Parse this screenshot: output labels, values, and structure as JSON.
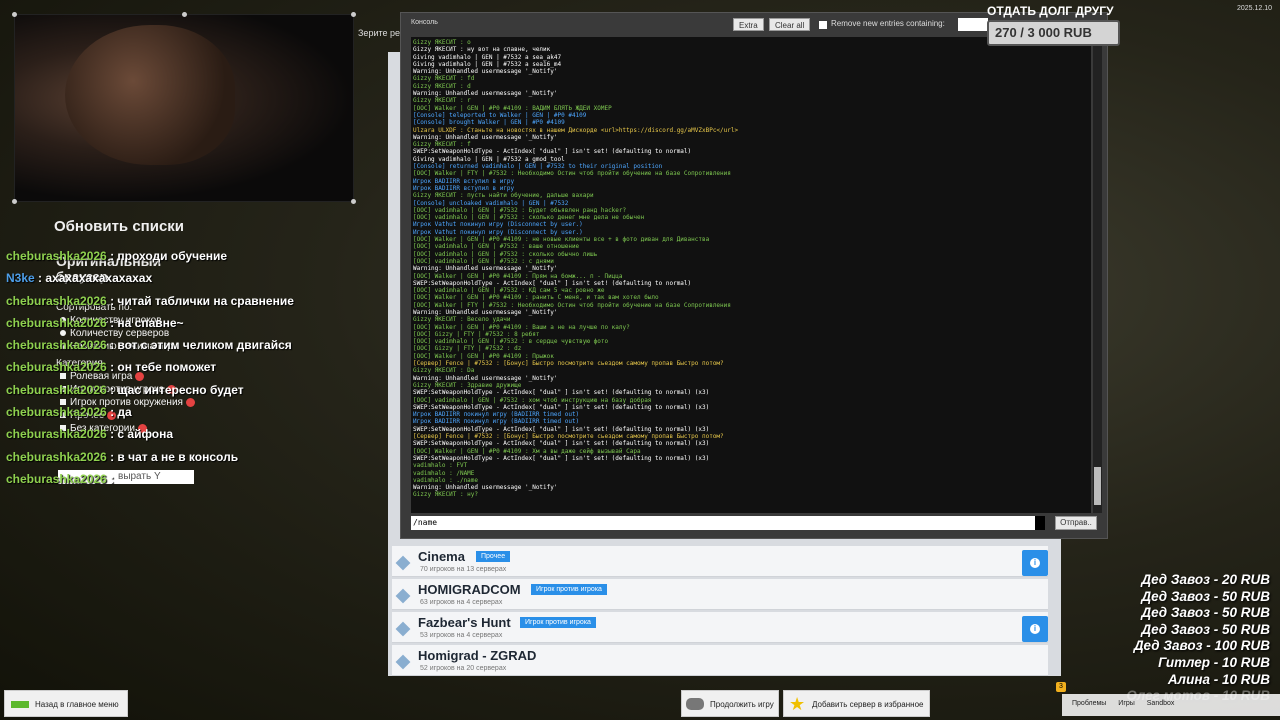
{
  "stream": {
    "refresh_lists": "Обновить списки",
    "zerite_text": "Зерите ре",
    "chat": [
      {
        "user": "cheburashka2026",
        "msg": " : проходи обучение",
        "user_color": "green"
      },
      {
        "user": "N3ke",
        "msg": " : ахахахахахахахах",
        "user_color": "blue"
      },
      {
        "user": "cheburashka2026",
        "msg": " : читай таблички на сравнение",
        "user_color": "green"
      },
      {
        "user": "cheburashka2026",
        "msg": " : на спавне~",
        "user_color": "green"
      },
      {
        "user": "cheburashka2026",
        "msg": " : вот с этим челиком двигайся",
        "user_color": "green"
      },
      {
        "user": "cheburashka2026",
        "msg": " : он тебе поможет",
        "user_color": "green"
      },
      {
        "user": "cheburashka2026",
        "msg": " : щас интересно будет",
        "user_color": "green"
      },
      {
        "user": "cheburashka2026",
        "msg": " : да",
        "user_color": "green"
      },
      {
        "user": "cheburashka2026",
        "msg": " : с айфона",
        "user_color": "green"
      },
      {
        "user": "cheburashka2026",
        "msg": " : в чат а не в консоль",
        "user_color": "green"
      },
      {
        "user": "cheburashka2026",
        "msg": " : ",
        "user_color": "green"
      }
    ],
    "filter": {
      "original": "Оригинальный",
      "browser": "браузер",
      "sort_by": "Сортировать по:",
      "sort_options": [
        "Количеству игроков",
        "Количеству серверов",
        "Названию режима игры"
      ],
      "category_label": "Категория",
      "categories": [
        "Ролевая игра",
        "Игрок против игрока",
        "Игрок против окружения",
        "Прочее",
        "Без категории"
      ],
      "search_hint": "вырать Y"
    }
  },
  "console": {
    "title": "Консоль",
    "extra_label": "Extra",
    "clear_label": "Clear all",
    "remove_label": "Remove new entries containing:",
    "input_value": "/name",
    "send_label": "Отправ..",
    "log": [
      {
        "t": "Gizzy ЯКЕСИТ : о",
        "c": "#7ec850"
      },
      {
        "t": "Gizzy ЯКЕСИТ : ну вот на спавне, челик",
        "c": "#ffffff"
      },
      {
        "t": "Giving vadimhalo | GEN | #7532 a sea_ak47",
        "c": "#ffffff"
      },
      {
        "t": "Giving vadimhalo | GEN | #7532 a sea16_m4",
        "c": "#ffffff"
      },
      {
        "t": "Warning: Unhandled usermessage '_Notify'",
        "c": "#ffffff"
      },
      {
        "t": "Gizzy ЯКЕСИТ : fd",
        "c": "#7ec850"
      },
      {
        "t": "Gizzy ЯКЕСИТ : d",
        "c": "#7ec850"
      },
      {
        "t": "Warning: Unhandled usermessage '_Notify'",
        "c": "#ffffff"
      },
      {
        "t": "Gizzy ЯКЕСИТ : r",
        "c": "#7ec850"
      },
      {
        "t": "[ООС] Walker | GEN | #P0 #4109 : ВАДИМ БЛЯТЬ ЖДЕЙ ХОМЕР",
        "c": "#7ec850"
      },
      {
        "t": "[Console] teleported to Walker | GEN | #P0 #4109",
        "c": "#4da6ff"
      },
      {
        "t": "[Console] brought Walker | GEN | #P0 #4109",
        "c": "#4da6ff"
      },
      {
        "t": "Ulzara ULXDF : Станьте на новостях в нашем Дискорде <url>https://discord.gg/aMVZxBPc</url>",
        "c": "#e8c84a"
      },
      {
        "t": "Warning: Unhandled usermessage '_Notify'",
        "c": "#ffffff"
      },
      {
        "t": "Gizzy ЯКЕСИТ : f",
        "c": "#7ec850"
      },
      {
        "t": "SWEP:SetWeaponHoldType - ActIndex[ \"dual\" ] isn't set! (defaulting to normal)",
        "c": "#ffffff"
      },
      {
        "t": "Giving vadimhalo | GEN | #7532 a gmod_tool",
        "c": "#ffffff"
      },
      {
        "t": "[Console] returned vadimhalo | GEN | #7532 to their original position",
        "c": "#4da6ff"
      },
      {
        "t": "[ООС] Walker | FTY | #7532 : Необходимо Остин чтоб пройти обучение на базе Сопротивления",
        "c": "#7ec850"
      },
      {
        "t": "Игрок BADIIRR вступил в игру",
        "c": "#4da6ff"
      },
      {
        "t": "Игрок BADIIRR вступил в игру",
        "c": "#4da6ff"
      },
      {
        "t": "Gizzy ЯКЕСИТ : пусть найти обучение, дальше вахари",
        "c": "#7ec850"
      },
      {
        "t": "[Console] uncloaked vadimhalo | GEN | #7532",
        "c": "#4da6ff"
      },
      {
        "t": "[ООС] vadimhalo | GEN | #7532 : Будет обьявлен ранд hacker?",
        "c": "#7ec850"
      },
      {
        "t": "[ООС] vadimhalo | GEN | #7532 : сколько денег мне дела не обычен",
        "c": "#7ec850"
      },
      {
        "t": "Игрок Vathut покинул игру (Disconnect by user.)",
        "c": "#4da6ff"
      },
      {
        "t": "Игрок Vathut покинул игру (Disconnect by user.)",
        "c": "#4da6ff"
      },
      {
        "t": "[ООС] Walker | GEN | #P0 #4109 : не новые клиенты все + в фото диван для Диванства",
        "c": "#7ec850"
      },
      {
        "t": "[ООС] vadimhalo | GEN | #7532 : ваше отношение",
        "c": "#7ec850"
      },
      {
        "t": "[ООС] vadimhalo | GEN | #7532 : сколько обычно лишь",
        "c": "#7ec850"
      },
      {
        "t": "[ООС] vadimhalo | GEN | #7532 : с днями",
        "c": "#7ec850"
      },
      {
        "t": "Warning: Unhandled usermessage '_Notify'",
        "c": "#ffffff"
      },
      {
        "t": "[ООС] Walker | GEN | #P0 #4109 : Прям на бомж... п - Пицца",
        "c": "#7ec850"
      },
      {
        "t": "SWEP:SetWeaponHoldType - ActIndex[ \"dual\" ] isn't set! (defaulting to normal)",
        "c": "#ffffff"
      },
      {
        "t": "[ООС] vadimhalo | GEN | #7532 : КД сам 5 час ровно же",
        "c": "#7ec850"
      },
      {
        "t": "[ООС] Walker | GEN | #P0 #4109 : ранить С меня, и так вам хотел было",
        "c": "#7ec850"
      },
      {
        "t": "[ООС] Walker | FTY | #7532 : Необходимо Остин чтоб пройти обучение на базе Сопротивления",
        "c": "#7ec850"
      },
      {
        "t": "Warning: Unhandled usermessage '_Notify'",
        "c": "#ffffff"
      },
      {
        "t": "Gizzy ЯКЕСИТ : Весело удачи",
        "c": "#7ec850"
      },
      {
        "t": "[ООС] Walker | GEN | #P0 #4109 : Ваши а не на лучше по калу?",
        "c": "#7ec850"
      },
      {
        "t": "[ООС] Gizzy | FTY | #7532 : 8 ребят",
        "c": "#7ec850"
      },
      {
        "t": "[ООС] vadimhalo | GEN | #7532 : в сердце чувствую фото",
        "c": "#7ec850"
      },
      {
        "t": "[ООС] Gizzy | FTY | #7532 : dz",
        "c": "#7ec850"
      },
      {
        "t": "[ООС] Walker | GEN | #P0 #4109 : Прыжок",
        "c": "#7ec850"
      },
      {
        "t": "[Сервер] Fence | #7532 : [Бонус] Быстро посмотрите сьездом самому пропав Быстро потом?",
        "c": "#e8c84a"
      },
      {
        "t": "Gizzy ЯКЕСИТ : Da",
        "c": "#7ec850"
      },
      {
        "t": "Warning: Unhandled usermessage '_Notify'",
        "c": "#ffffff"
      },
      {
        "t": "Gizzy ЯКЕСИТ : Здравие дружище",
        "c": "#7ec850"
      },
      {
        "t": "SWEP:SetWeaponHoldType - ActIndex[ \"dual\" ] isn't set! (defaulting to normal) (x3)",
        "c": "#ffffff"
      },
      {
        "t": "[ООС] vadimhalo | GEN | #7532 : хом чтоб инструкцию на базу добрая",
        "c": "#7ec850"
      },
      {
        "t": "SWEP:SetWeaponHoldType - ActIndex[ \"dual\" ] isn't set! (defaulting to normal) (x3)",
        "c": "#ffffff"
      },
      {
        "t": "Игрок BADIIRR покинул игру (BADIIRR timed out)",
        "c": "#4da6ff"
      },
      {
        "t": "Игрок BADIIRR покинул игру (BADIIRR timed out)",
        "c": "#4da6ff"
      },
      {
        "t": "SWEP:SetWeaponHoldType - ActIndex[ \"dual\" ] isn't set! (defaulting to normal) (x3)",
        "c": "#ffffff"
      },
      {
        "t": "[Сервер] Fence | #7532 : [Бонус] Быстро посмотрите сьездом самому пропав Быстро потом?",
        "c": "#e8c84a"
      },
      {
        "t": "SWEP:SetWeaponHoldType - ActIndex[ \"dual\" ] isn't set! (defaulting to normal) (x3)",
        "c": "#ffffff"
      },
      {
        "t": "[ООС] Walker | GEN | #P0 #4109 : Хм а вы даже сейф вызывай Сара",
        "c": "#7ec850"
      },
      {
        "t": "SWEP:SetWeaponHoldType - ActIndex[ \"dual\" ] isn't set! (defaulting to normal) (x3)",
        "c": "#ffffff"
      },
      {
        "t": "vadimhalo : FVT",
        "c": "#7ec850"
      },
      {
        "t": "vadimhalo : /NAME",
        "c": "#7ec850"
      },
      {
        "t": "vadimhalo : ./name",
        "c": "#7ec850"
      },
      {
        "t": "Warning: Unhandled usermessage '_Notify'",
        "c": "#ffffff"
      },
      {
        "t": "Gizzy ЯКЕСИТ : ну?",
        "c": "#7ec850"
      }
    ]
  },
  "servers": [
    {
      "name": "Cinema",
      "tag": "Прочее",
      "sub": "70 игроков на 13 серверах",
      "info": true
    },
    {
      "name": "HOMIGRADCOM",
      "tag": "Игрок против игрока",
      "sub": "63 игроков на 4 серверах",
      "info": false
    },
    {
      "name": "Fazbear's Hunt",
      "tag": "Игрок против игрока",
      "sub": "53 игроков на 4 серверах",
      "info": true
    },
    {
      "name": "Homigrad - ZGRAD",
      "tag": "",
      "sub": "52 игроков на 20 серверах",
      "info": false
    }
  ],
  "hud": {
    "debt_title": "ОТДАТЬ ДОЛГ ДРУГУ",
    "debt_progress": "270 / 3 000 RUB",
    "date": "2025.12.10"
  },
  "donations": [
    {
      "text": "Дед Завоз - 20 RUB",
      "faded": false
    },
    {
      "text": "Дед Завоз - 50 RUB",
      "faded": false
    },
    {
      "text": "Дед Завоз - 50 RUB",
      "faded": false
    },
    {
      "text": "Дед Завоз - 50 RUB",
      "faded": false
    },
    {
      "text": "Дед Завоз - 100 RUB",
      "faded": false
    },
    {
      "text": "Гитлер - 10 RUB",
      "faded": false
    },
    {
      "text": "Алина - 10 RUB",
      "faded": false
    },
    {
      "text": "Олег мотов - 10 RUB",
      "faded": true
    }
  ],
  "bottom": {
    "back_label": "Назад в главное меню",
    "continue_label": "Продолжить игру",
    "favorite_label": "Добавить сервер в избранное",
    "tray": {
      "badge": "3",
      "problems": "Проблемы",
      "games": "Игры",
      "sandbox": "Sandbox"
    }
  },
  "colors": {
    "accent": "#2a8fe8",
    "chat_user": "#8fd14f",
    "console_bg": "#3a3a3a"
  }
}
